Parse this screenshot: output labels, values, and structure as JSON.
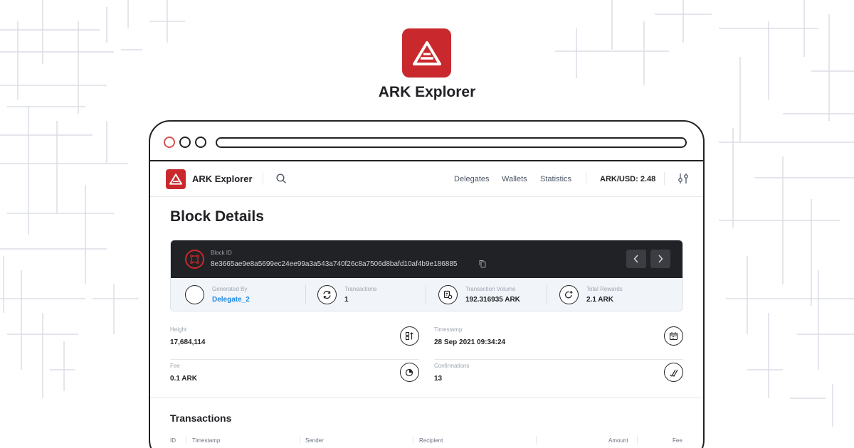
{
  "brand": {
    "title": "ARK Explorer"
  },
  "navbar": {
    "title": "ARK Explorer",
    "links": [
      "Delegates",
      "Wallets",
      "Statistics"
    ],
    "price": "ARK/USD: 2.48"
  },
  "page": {
    "title": "Block Details"
  },
  "block": {
    "id_label": "Block ID",
    "id_value": "8e3665ae9e8a5699ec24ee99a3a543a740f26c8a7506d8bafd10af4b9e186885",
    "stats": [
      {
        "label": "Generated By",
        "value": "Delegate_2"
      },
      {
        "label": "Transactions",
        "value": "1"
      },
      {
        "label": "Transaction Volume",
        "value": "192.316935 ARK"
      },
      {
        "label": "Total Rewards",
        "value": "2.1 ARK"
      }
    ]
  },
  "details": [
    {
      "label": "Height",
      "value": "17,684,114"
    },
    {
      "label": "Timestamp",
      "value": "28 Sep 2021 09:34:24"
    },
    {
      "label": "Fee",
      "value": "0.1 ARK"
    },
    {
      "label": "Confirmations",
      "value": "13"
    }
  ],
  "transactions": {
    "title": "Transactions",
    "columns": [
      "ID",
      "Timestamp",
      "Sender",
      "Recipient",
      "Amount",
      "Fee"
    ]
  },
  "colors": {
    "brand_red": "#c9292c",
    "dark": "#212225",
    "link_blue": "#1e88e5"
  },
  "icons": [
    "ark-logo-icon",
    "search-icon",
    "settings-icon",
    "block-icon",
    "copy-icon",
    "chevron-left-icon",
    "chevron-right-icon",
    "refresh-icon",
    "volume-icon",
    "rewards-icon",
    "height-icon",
    "calendar-icon",
    "fee-icon",
    "confirmations-icon"
  ]
}
